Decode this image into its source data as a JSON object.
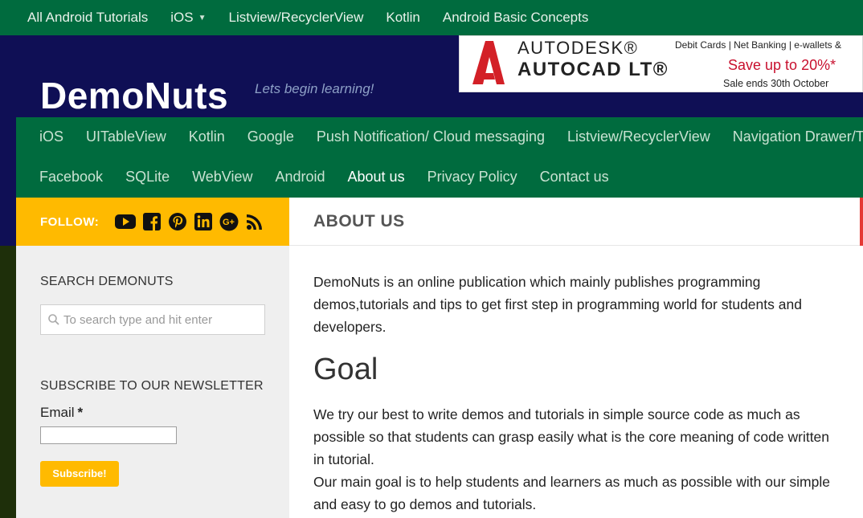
{
  "topnav": {
    "items": [
      {
        "label": "All Android Tutorials"
      },
      {
        "label": "iOS",
        "has_caret": true
      },
      {
        "label": "Listview/RecyclerView"
      },
      {
        "label": "Kotlin"
      },
      {
        "label": "Android Basic Concepts"
      }
    ]
  },
  "site": {
    "title": "DemoNuts",
    "tagline": "Lets begin learning!"
  },
  "ad": {
    "brand_line1": "AUTODESK®",
    "brand_line2": "AUTOCAD LT®",
    "payment": "Debit Cards | Net Banking | e-wallets &",
    "offer": "Save up to 20%*",
    "ends": "Sale ends 30th October"
  },
  "mainmenu": {
    "row1": [
      "iOS",
      "UITableView",
      "Kotlin",
      "Google",
      "Push Notification/ Cloud messaging",
      "Listview/RecyclerView",
      "Navigation Drawer/Ta"
    ],
    "row2": [
      "Facebook",
      "SQLite",
      "WebView",
      "Android",
      "About us",
      "Privacy Policy",
      "Contact us"
    ],
    "active": "About us"
  },
  "follow": {
    "label": "FOLLOW:",
    "icons": [
      "youtube-icon",
      "facebook-icon",
      "pinterest-icon",
      "linkedin-icon",
      "google-plus-icon",
      "rss-icon"
    ]
  },
  "page": {
    "title": "ABOUT US"
  },
  "sidebar": {
    "search_heading": "SEARCH DEMONUTS",
    "search_placeholder": "To search type and hit enter",
    "newsletter_heading": "SUBSCRIBE TO OUR NEWSLETTER",
    "email_label": "Email",
    "required_mark": "*",
    "subscribe_label": "Subscribe!"
  },
  "content": {
    "intro": "DemoNuts is an online publication which mainly publishes programming demos,tutorials and tips to get first step in programming world for students and developers.",
    "goal_heading": "Goal",
    "goal_p1": "We try our best to write demos and tutorials in simple source code as much as possible so that students can grasp easily what is the core meaning of code written in tutorial.",
    "goal_p2": "Our main goal is to help students and learners as much as possible with our simple and easy to go demos and tutorials."
  },
  "colors": {
    "nav_green": "#006b3e",
    "header_navy": "#0f0f55",
    "follow_yellow": "#ffba00",
    "accent_red": "#e53935"
  }
}
